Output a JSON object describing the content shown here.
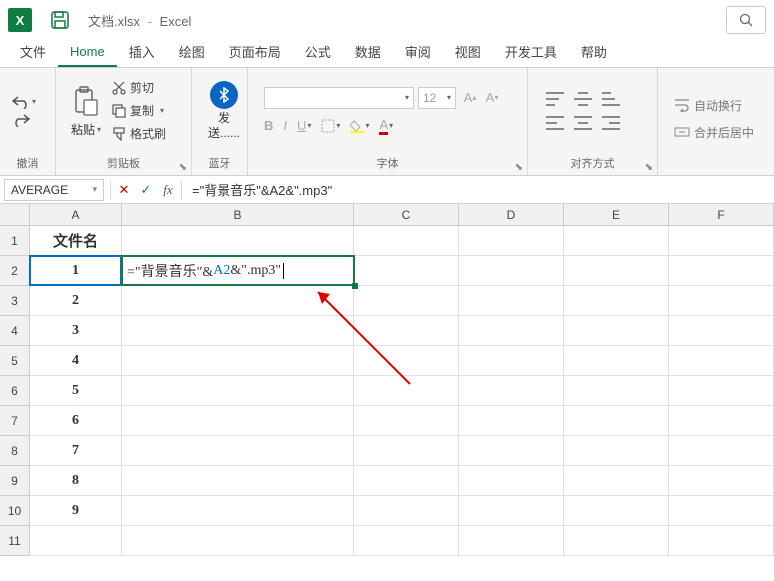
{
  "title": {
    "filename": "文档.xlsx",
    "app": "Excel"
  },
  "menu": {
    "file": "文件",
    "home": "Home",
    "insert": "插入",
    "draw": "绘图",
    "layout": "页面布局",
    "formulas": "公式",
    "data": "数据",
    "review": "审阅",
    "view": "视图",
    "dev": "开发工具",
    "help": "帮助"
  },
  "ribbon": {
    "undo_group": "撤消",
    "clipboard_group": "剪贴板",
    "paste": "粘贴",
    "cut": "剪切",
    "copy": "复制",
    "format_painter": "格式刷",
    "bluetooth_group": "蓝牙",
    "send": "发送......",
    "font_group": "字体",
    "font_size": "12",
    "align_group": "对齐方式",
    "wrap_text": "自动换行",
    "merge_center": "合并后居中"
  },
  "formula_bar": {
    "name_box": "AVERAGE",
    "formula": "=\"背景音乐\"&A2&\".mp3\""
  },
  "columns": [
    "A",
    "B",
    "C",
    "D",
    "E",
    "F"
  ],
  "rows": [
    "1",
    "2",
    "3",
    "4",
    "5",
    "6",
    "7",
    "8",
    "9",
    "10",
    "11"
  ],
  "sheet": {
    "a1": "文件名",
    "a_values": [
      "1",
      "2",
      "3",
      "4",
      "5",
      "6",
      "7",
      "8",
      "9"
    ],
    "b2_edit": {
      "prefix": "=\"背景音乐\"&",
      "ref": "A2",
      "suffix": "&\".mp3\""
    }
  }
}
